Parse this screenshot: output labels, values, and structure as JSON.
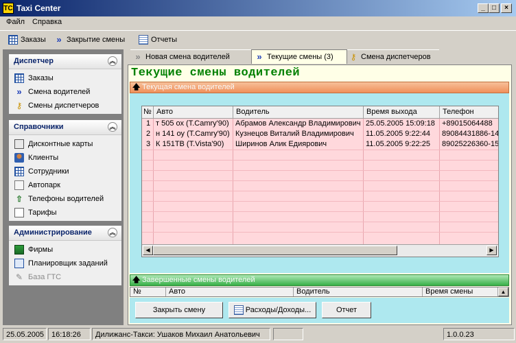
{
  "window": {
    "title": "Taxi Center",
    "app_icon": "TC",
    "controls": [
      "_",
      "□",
      "×"
    ]
  },
  "menu": {
    "items": [
      "Файл",
      "Справка"
    ]
  },
  "toolbar": {
    "items": [
      {
        "label": "Заказы",
        "icon": "orders-icon"
      },
      {
        "label": "Закрытие смены",
        "icon": "double-arrow-icon"
      },
      {
        "label": "Отчеты",
        "icon": "reports-icon"
      }
    ]
  },
  "sidebar": {
    "groups": [
      {
        "title": "Диспетчер",
        "items": [
          {
            "label": "Заказы",
            "icon": "orders-icon"
          },
          {
            "label": "Смена водителей",
            "icon": "double-arrow-icon"
          },
          {
            "label": "Смены диспетчеров",
            "icon": "key-icon"
          }
        ]
      },
      {
        "title": "Справочники",
        "items": [
          {
            "label": "Дисконтные карты",
            "icon": "card-icon"
          },
          {
            "label": "Клиенты",
            "icon": "clients-icon"
          },
          {
            "label": "Сотрудники",
            "icon": "employees-icon"
          },
          {
            "label": "Автопарк",
            "icon": "fleet-icon"
          },
          {
            "label": "Телефоны водителей",
            "icon": "phone-icon"
          },
          {
            "label": "Тарифы",
            "icon": "tariff-icon"
          }
        ]
      },
      {
        "title": "Администрирование",
        "items": [
          {
            "label": "Фирмы",
            "icon": "firm-icon"
          },
          {
            "label": "Планировщик заданий",
            "icon": "scheduler-icon"
          },
          {
            "label": "База ГТС",
            "icon": "database-icon",
            "disabled": true
          }
        ]
      }
    ]
  },
  "tabs": [
    {
      "label": "Новая смена водителей",
      "active": false
    },
    {
      "label": "Текущие смены (3)",
      "active": true
    },
    {
      "label": "Смена диспетчеров",
      "active": false
    }
  ],
  "main": {
    "title": "Текущие смены водителей",
    "current_bar_label": "Текущая смена водителей",
    "current_table": {
      "columns": [
        "№",
        "Авто",
        "Водитель",
        "Время выхода",
        "Телефон"
      ],
      "rows": [
        [
          "1",
          "т 505 ох (T.Camry'90)",
          "Абрамов Александр Владимирович",
          "25.05.2005 15:09:18",
          "+89015064488"
        ],
        [
          "2",
          "н 141 оу (T.Camry'90)",
          "Кузнецов Виталий Владимирович",
          "11.05.2005 9:22:44",
          "89084431886-14"
        ],
        [
          "3",
          "К 151ТВ (T.Vista'90)",
          "Ширинов Алик Едиярович",
          "11.05.2005 9:22:25",
          "89025226360-15"
        ]
      ]
    },
    "finished_bar_label": "Завершенные смены водителей",
    "finished_table": {
      "columns": [
        "№",
        "Авто",
        "Водитель",
        "Время смены"
      ]
    },
    "buttons": {
      "close_shift": "Закрыть смену",
      "expenses": "Расходы/Доходы...",
      "report": "Отчет"
    }
  },
  "status": {
    "date": "25.05.2005",
    "time": "16:18:26",
    "company_user": "Дилижанс-Такси: Ушаков Михаил Анатольевич",
    "version": "1.0.0.23"
  },
  "colors": {
    "title_green": "#008000",
    "grid_row_bg": "#ffd8dc",
    "panel_bg": "#aee8ef",
    "content_bg": "#ffffe7",
    "orange_bar": "#f0905a",
    "green_bar": "#38b048"
  }
}
